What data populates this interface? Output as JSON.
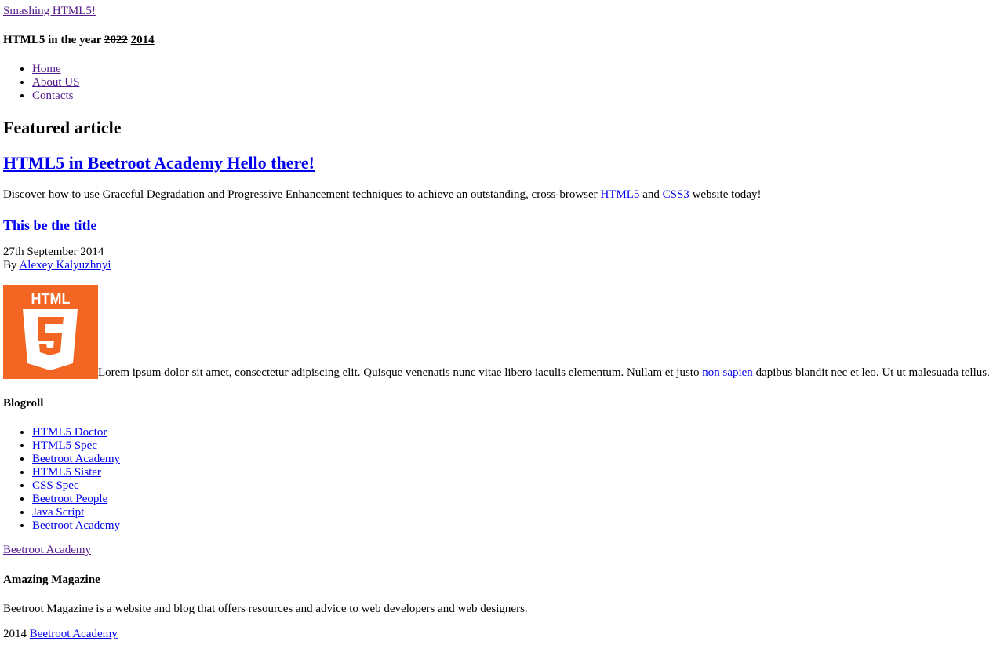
{
  "header": {
    "site_link": "Smashing HTML5!",
    "tagline_prefix": "HTML5 in the year",
    "tagline_old_year": "2022",
    "tagline_new_year": "2014"
  },
  "nav": {
    "items": [
      {
        "label": "Home"
      },
      {
        "label": "About US"
      },
      {
        "label": "Contacts"
      }
    ]
  },
  "featured": {
    "heading": "Featured article",
    "title": "HTML5 in Beetroot Academy Hello there!",
    "desc_part1": "Discover how to use Graceful Degradation and Progressive Enhancement techniques to achieve an outstanding, cross-browser",
    "desc_link1": "HTML5",
    "desc_and": "and",
    "desc_link2": "CSS3",
    "desc_part2": "website today!"
  },
  "post": {
    "title": "This be the title",
    "date": "27th September 2014",
    "by_label": "By",
    "author": "Alexey Kalyuzhnyi",
    "logo_text": "HTML",
    "body_part1": "Lorem ipsum dolor sit amet, consectetur adipiscing elit. Quisque venenatis nunc vitae libero iaculis elementum. Nullam et justo",
    "body_link": "non sapien",
    "body_part2": "dapibus blandit nec et leo. Ut ut malesuada tellus."
  },
  "blogroll": {
    "heading": "Blogroll",
    "items": [
      {
        "label": "HTML5 Doctor"
      },
      {
        "label": "HTML5 Spec"
      },
      {
        "label": "Beetroot Academy"
      },
      {
        "label": "HTML5 Sister"
      },
      {
        "label": "CSS Spec"
      },
      {
        "label": "Beetroot People"
      },
      {
        "label": "Java Script"
      },
      {
        "label": "Beetroot Academy"
      }
    ]
  },
  "footer": {
    "brand_link": "Beetroot Academy",
    "heading": "Amazing Magazine",
    "desc": "Beetroot Magazine is a website and blog that offers resources and advice to web developers and web designers.",
    "copy_year": "2014",
    "copy_link": "Beetroot Academy"
  },
  "colors": {
    "link": "#0000ee",
    "visited_link": "#551a8b",
    "logo_orange": "#f26522"
  }
}
